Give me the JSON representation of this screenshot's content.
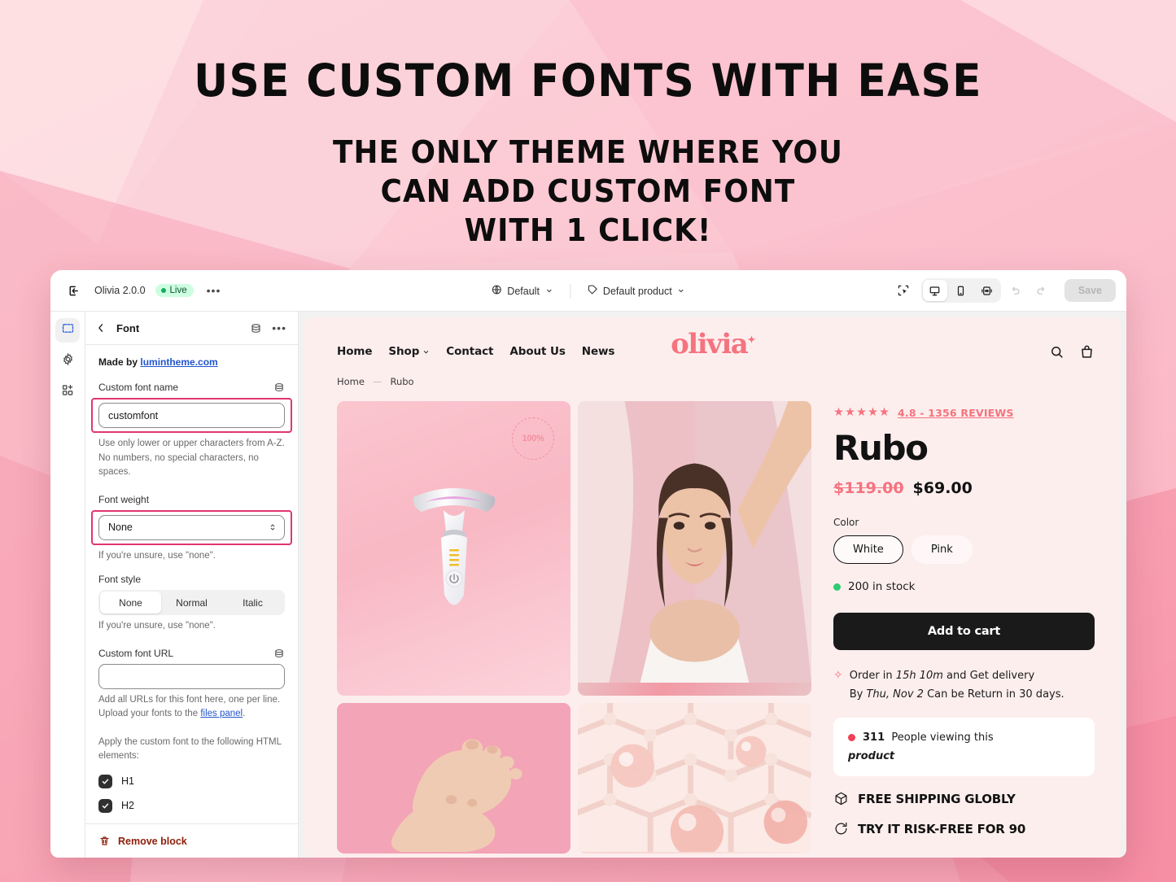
{
  "promo": {
    "headline": "USE CUSTOM FONTS WITH EASE",
    "sub_line1": "THE ONLY THEME WHERE YOU",
    "sub_line2": "CAN ADD CUSTOM FONT",
    "sub_line3": "WITH 1 CLICK!"
  },
  "topbar": {
    "exit_icon": "exit-icon",
    "theme_name": "Olivia 2.0.0",
    "status_badge": "Live",
    "more_menu": "•••",
    "globe_icon": "globe-icon",
    "locale": "Default",
    "tag_icon": "tag-icon",
    "template": "Default product",
    "inspect_icon": "inspector-icon",
    "device_desktop_icon": "desktop-icon",
    "device_mobile_icon": "mobile-icon",
    "device_full_icon": "fullwidth-icon",
    "undo_icon": "undo-icon",
    "redo_icon": "redo-icon",
    "save_label": "Save"
  },
  "rail": {
    "items": [
      {
        "name": "sections-icon",
        "label": "Sections"
      },
      {
        "name": "settings-gear-icon",
        "label": "Theme settings"
      },
      {
        "name": "apps-add-icon",
        "label": "Apps"
      }
    ]
  },
  "panel": {
    "back_icon": "chevron-left-icon",
    "title": "Font",
    "db_icon": "dynamic-source-icon",
    "more_icon": "•••",
    "made_by_prefix": "Made by ",
    "made_by_link": "lumintheme.com",
    "custom_font_name": {
      "label": "Custom font name",
      "value": "customfont",
      "placeholder": "",
      "helper": "Use only lower or upper characters from A-Z. No numbers, no special characters, no spaces."
    },
    "font_weight": {
      "label": "Font weight",
      "value": "None",
      "helper": "If you're unsure, use \"none\"."
    },
    "font_style": {
      "label": "Font style",
      "options": [
        "None",
        "Normal",
        "Italic"
      ],
      "selected": "None",
      "helper": "If you're unsure, use \"none\"."
    },
    "custom_font_url": {
      "label": "Custom font URL",
      "value": "",
      "placeholder": "",
      "helper_line1": "Add all URLs for this font here, one per line.",
      "helper_line2_pre": "Upload your fonts to the ",
      "helper_line2_link": "files panel",
      "helper_line2_post": "."
    },
    "apply_label": "Apply the custom font to the following HTML elements:",
    "checkboxes": [
      {
        "label": "H1",
        "checked": true
      },
      {
        "label": "H2",
        "checked": true
      }
    ],
    "footer": {
      "trash_icon": "trash-icon",
      "remove_label": "Remove block"
    }
  },
  "storefront": {
    "nav": {
      "links": [
        {
          "label": "Home",
          "caret": false
        },
        {
          "label": "Shop",
          "caret": true
        },
        {
          "label": "Contact",
          "caret": false
        },
        {
          "label": "About Us",
          "caret": false
        },
        {
          "label": "News",
          "caret": false
        }
      ],
      "brand": "olivia",
      "search_icon": "search-icon",
      "cart_icon": "shopping-bag-icon"
    },
    "breadcrumb": {
      "home": "Home",
      "separator": "—",
      "current": "Rubo"
    },
    "gallery": [
      {
        "name": "product-hero-image",
        "badge": "100%"
      },
      {
        "name": "model-lifestyle-image",
        "badge": ""
      },
      {
        "name": "feet-closeup-image",
        "badge": ""
      },
      {
        "name": "molecule-texture-image",
        "badge": ""
      }
    ],
    "product": {
      "stars": "★★★★★",
      "reviews_link": "4.8 - 1356 REVIEWS",
      "title": "Rubo",
      "price_old": "$119.00",
      "price_new": "$69.00",
      "option_label": "Color",
      "options": [
        {
          "label": "White",
          "selected": true
        },
        {
          "label": "Pink",
          "selected": false
        }
      ],
      "stock": "200 in stock",
      "add_to_cart": "Add to cart",
      "delivery_line1_a": "Order in ",
      "delivery_countdown": "15h 10m",
      "delivery_line1_b": " and Get delivery",
      "delivery_line2_a": "By ",
      "delivery_date": "Thu, Nov 2",
      "delivery_line2_b": " Can be Return in 30 days.",
      "viewing_count": "311",
      "viewing_text": "People viewing this",
      "viewing_emph": "product",
      "perk1_icon": "box-icon",
      "perk1": "FREE SHIPPING GLOBLY",
      "perk2_icon": "refresh-icon",
      "perk2": "TRY IT RISK-FREE FOR 90"
    }
  },
  "colors": {
    "accent_pink": "#f4737f",
    "highlight_outline": "#e1356f",
    "live_green": "#14ae5c",
    "stock_green": "#2ecc71",
    "viewing_red": "#ef4056",
    "remove_red": "#8e1f0b",
    "link_blue": "#2255cc",
    "storefront_bg": "#fdeeee"
  }
}
